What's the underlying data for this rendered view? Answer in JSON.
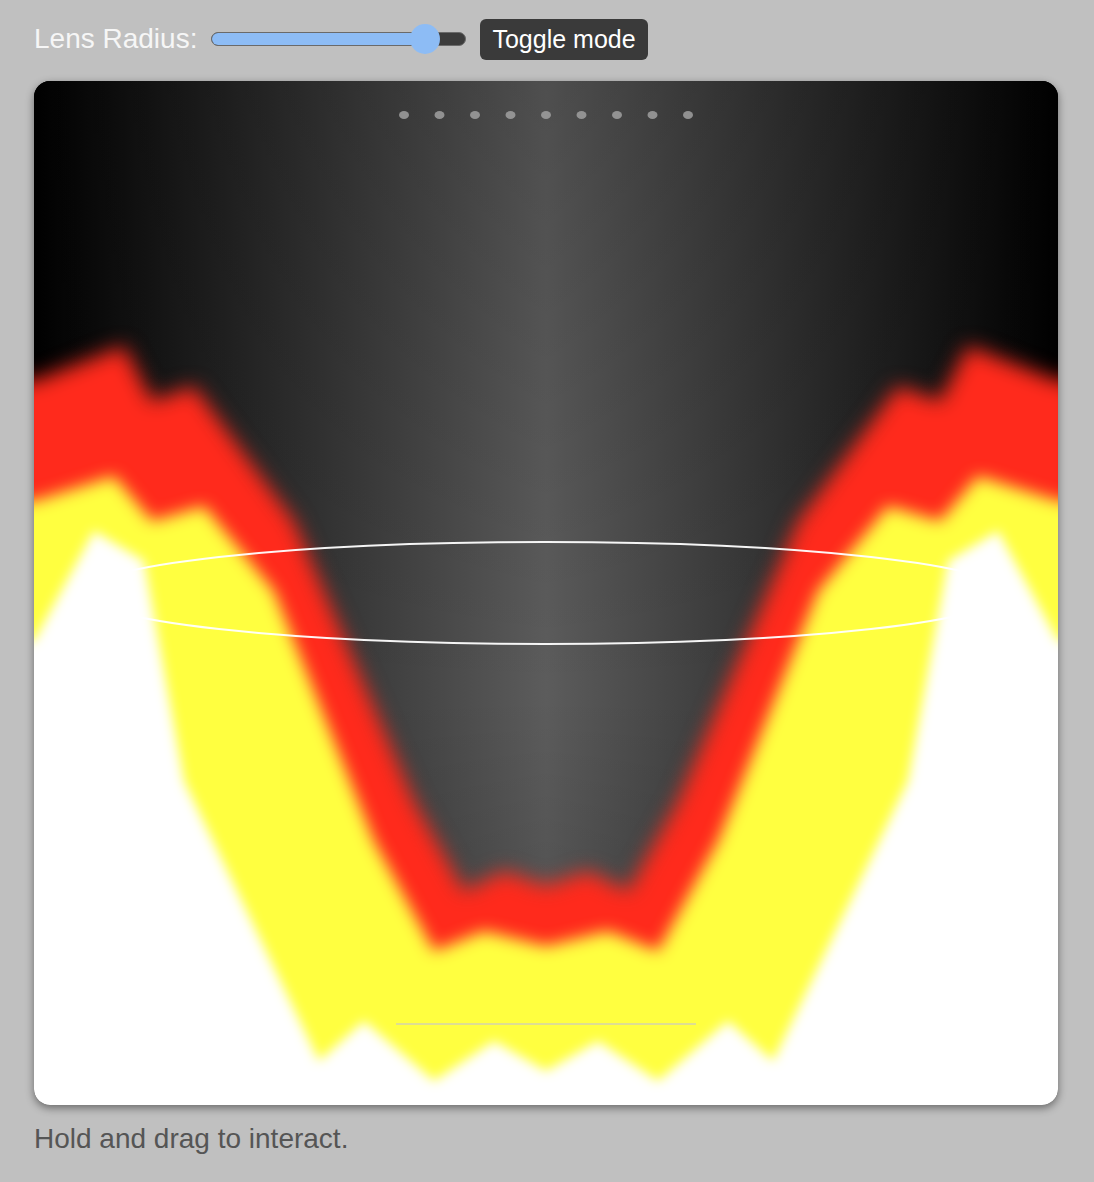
{
  "controls": {
    "label": "Lens Radius:",
    "slider": {
      "level": 0.84
    },
    "button": "Toggle mode"
  },
  "hint": "Hold and drag to interact."
}
